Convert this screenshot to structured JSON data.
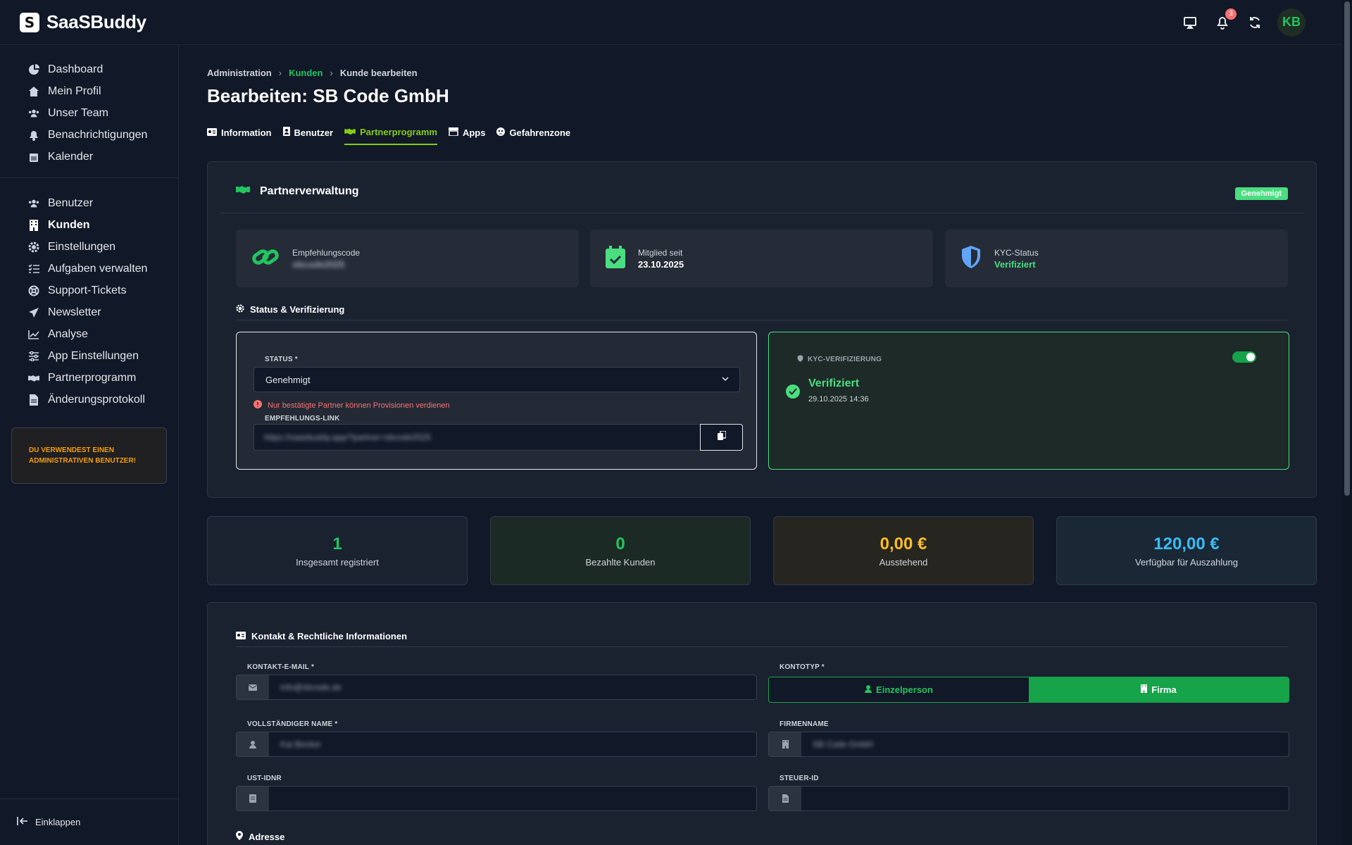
{
  "app": {
    "name": "SaaSBuddy",
    "logo_letter": "S"
  },
  "topbar": {
    "notification_count": "3",
    "avatar_initials": "KB"
  },
  "sidebar": {
    "main_items": [
      {
        "label": "Dashboard",
        "icon": "pie-chart-icon"
      },
      {
        "label": "Mein Profil",
        "icon": "home-icon"
      },
      {
        "label": "Unser Team",
        "icon": "team-icon"
      },
      {
        "label": "Benachrichtigungen",
        "icon": "bell-icon"
      },
      {
        "label": "Kalender",
        "icon": "calendar-icon"
      }
    ],
    "admin_items": [
      {
        "label": "Benutzer",
        "icon": "users-icon"
      },
      {
        "label": "Kunden",
        "icon": "building-icon",
        "active": true
      },
      {
        "label": "Einstellungen",
        "icon": "gear-icon"
      },
      {
        "label": "Aufgaben verwalten",
        "icon": "task-list-icon"
      },
      {
        "label": "Support-Tickets",
        "icon": "lifebuoy-icon"
      },
      {
        "label": "Newsletter",
        "icon": "paper-plane-icon"
      },
      {
        "label": "Analyse",
        "icon": "line-chart-icon"
      },
      {
        "label": "App Einstellungen",
        "icon": "sliders-icon"
      },
      {
        "label": "Partnerprogramm",
        "icon": "handshake-icon"
      },
      {
        "label": "Änderungsprotokoll",
        "icon": "document-icon"
      }
    ],
    "admin_notice_line1": "DU VERWENDEST EINEN",
    "admin_notice_line2": "ADMINISTRATIVEN BENUTZER!",
    "collapse_label": "Einklappen"
  },
  "breadcrumb": [
    "Administration",
    "Kunden",
    "Kunde bearbeiten"
  ],
  "page_title": "Bearbeiten: SB Code GmbH",
  "tabs": [
    {
      "label": "Information",
      "icon": "id-card-icon"
    },
    {
      "label": "Benutzer",
      "icon": "user-badge-icon"
    },
    {
      "label": "Partnerprogramm",
      "icon": "handshake-icon",
      "active": true
    },
    {
      "label": "Apps",
      "icon": "store-icon"
    },
    {
      "label": "Gefahrenzone",
      "icon": "skull-icon"
    }
  ],
  "partner": {
    "title": "Partnerverwaltung",
    "status_badge": "Genehmigt",
    "tiles": {
      "referral_label": "Empfehlungscode",
      "referral_value": "sbcode2025",
      "member_label": "Mitglied seit",
      "member_value": "23.10.2025",
      "kyc_label": "KYC-Status",
      "kyc_value": "Verifiziert"
    },
    "status_section_title": "Status & Verifizierung",
    "status_label": "STATUS *",
    "status_value": "Genehmigt",
    "warning": "Nur bestätigte Partner können Provisionen verdienen",
    "link_label": "EMPFEHLUNGS-LINK",
    "link_value": "https://saasbuddy.app/?partner=sbcode2025",
    "kyc_box_label": "KYC-VERIFIZIERUNG",
    "kyc_box_status": "Verifiziert",
    "kyc_box_date": "29.10.2025 14:36"
  },
  "stats": [
    {
      "value": "1",
      "label": "Insgesamt registriert",
      "color": "#22c55e"
    },
    {
      "value": "0",
      "label": "Bezahlte Kunden",
      "color": "#22c55e"
    },
    {
      "value": "0,00 €",
      "label": "Ausstehend",
      "color": "#fbbf24"
    },
    {
      "value": "120,00 €",
      "label": "Verfügbar für Auszahlung",
      "color": "#38bdf8"
    }
  ],
  "contact": {
    "title": "Kontakt & Rechtliche Informationen",
    "email_label": "KONTAKT-E-MAIL *",
    "email_value": "info@sbcode.de",
    "account_type_label": "KONTOTYP *",
    "account_type_person": "Einzelperson",
    "account_type_company": "Firma",
    "name_label": "VOLLSTÄNDIGER NAME *",
    "name_value": "Kai Becker",
    "company_label": "FIRMENNAME",
    "company_value": "SB Code GmbH",
    "vat_label": "UST-IDNR",
    "vat_value": "",
    "tax_label": "STEUER-ID",
    "tax_value": "",
    "address_title": "Adresse"
  },
  "colors": {
    "accent": "#22c55e",
    "tab_active": "#84cc16",
    "warning": "#f87171"
  }
}
